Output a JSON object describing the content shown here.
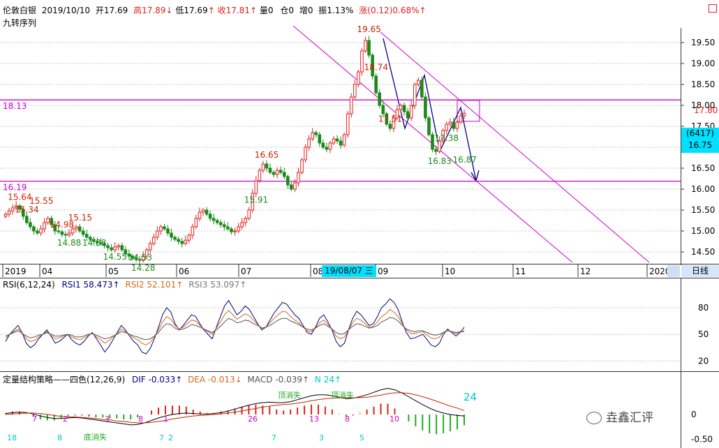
{
  "header": {
    "name": "伦敦白银",
    "date": "2019/10/10",
    "open_label": "开",
    "open": "17.69",
    "high_label": "高",
    "high": "17.89",
    "low_label": "低",
    "low": "17.69",
    "close_label": "收",
    "close": "17.81",
    "vol_label": "量",
    "vol": "0",
    "oi_label": "仓",
    "oi": "0",
    "inc_label": "增",
    "inc": "0",
    "amp_label": "振",
    "amp": "1.13%",
    "chg_label": "涨",
    "chg": "(0.12)",
    "chg_pct": "0.68%",
    "indicator": "九转序列",
    "corner_icon": "square-icon",
    "arrow_up": "↑",
    "arrow_down": "↓"
  },
  "colors": {
    "up": "#e02020",
    "down": "#1a8a1a",
    "magenta": "#cc00cc",
    "rsi1": "#000080",
    "rsi2": "#d2691e",
    "rsi3": "#555555",
    "dif": "#000000",
    "dea": "#cc2200",
    "cyan": "#00c8c8",
    "label_blue": "#1010a0"
  },
  "price_axis": [
    "19.50",
    "19.00",
    "18.50",
    "18.00",
    "17.50",
    "17.00",
    "16.50",
    "16.00",
    "15.50",
    "15.00",
    "14.50"
  ],
  "current_price_tag": "17.80",
  "cursor_tag": {
    "line1": "(6417)",
    "line2": "16.75"
  },
  "support_lines": [
    {
      "label": "18.13",
      "value": 18.13
    },
    {
      "label": "16.19",
      "value": 16.19
    }
  ],
  "price_annotations": [
    {
      "text": "19.65",
      "kind": "high"
    },
    {
      "text": "18.74",
      "kind": "high"
    },
    {
      "text": "17.51",
      "kind": "high"
    },
    {
      "text": "16.65",
      "kind": "high"
    },
    {
      "text": "15.64",
      "kind": "high"
    },
    {
      "text": "15.34",
      "kind": "high"
    },
    {
      "text": "14.98",
      "kind": "high"
    },
    {
      "text": "15.15",
      "kind": "high"
    },
    {
      "text": "15.55",
      "kind": "high"
    },
    {
      "text": "14.88",
      "kind": "low"
    },
    {
      "text": "14.55",
      "kind": "low"
    },
    {
      "text": "14.28",
      "kind": "low"
    },
    {
      "text": "14.53",
      "kind": "low"
    },
    {
      "text": "14.88",
      "kind": "low"
    },
    {
      "text": "15.91",
      "kind": "low"
    },
    {
      "text": "16.83",
      "kind": "low"
    },
    {
      "text": "17.38",
      "kind": "low"
    },
    {
      "text": "16.87",
      "kind": "low"
    }
  ],
  "time_axis": [
    "2019",
    "04",
    "05",
    "06",
    "07",
    "08",
    "09",
    "10",
    "11",
    "12",
    "2020"
  ],
  "time_cursor": "19/08/07 三",
  "period": "日线",
  "rsi": {
    "title": "RSI(6,12,24)",
    "rsi1_label": "RSI1",
    "rsi1": "58.473",
    "rsi2_label": "RSI2",
    "rsi2": "52.101",
    "rsi3_label": "RSI3",
    "rsi3": "53.097",
    "axis": [
      "80",
      "50",
      "20"
    ]
  },
  "macd": {
    "title": "定量结构策略——四色(12,26,9)",
    "dif_label": "DIF",
    "dif": "-0.033",
    "dea_label": "DEA",
    "dea": "-0.013",
    "macd_label": "MACD",
    "macd": "-0.039",
    "n_label": "N",
    "n": "24",
    "axis": [
      "-0.50",
      "0"
    ],
    "big_number": "24",
    "tags": [
      "顶消失",
      "顶消失"
    ],
    "counts_top": [
      "7",
      "2",
      "3",
      "8",
      "1",
      "26",
      "13",
      "8",
      "10"
    ],
    "counts_bottom": [
      "18",
      "8",
      "7",
      "2",
      "7",
      "3",
      "5"
    ],
    "bottom_text": "底消失"
  },
  "watermark": "垚鑫汇评",
  "chart_data": [
    {
      "type": "candlestick",
      "title": "伦敦白银",
      "xlabel": "",
      "ylabel": "",
      "x_ticks": [
        "2019",
        "04",
        "05",
        "06",
        "07",
        "08",
        "09",
        "10",
        "11",
        "12",
        "2020"
      ],
      "ylim": [
        14.25,
        19.85
      ],
      "annotated_highs": [
        19.65,
        18.74,
        17.51,
        16.65,
        15.64,
        15.34,
        14.98,
        15.15,
        15.55
      ],
      "annotated_lows": [
        14.88,
        14.55,
        14.28,
        14.53,
        14.88,
        15.91,
        16.83,
        17.38,
        16.87
      ],
      "horizontal_lines": [
        18.13,
        16.19
      ],
      "close_series": [
        15.4,
        15.48,
        15.55,
        15.6,
        15.52,
        15.35,
        15.2,
        15.1,
        15.0,
        14.95,
        15.05,
        15.2,
        15.3,
        15.15,
        15.0,
        14.98,
        14.92,
        14.9,
        14.95,
        15.05,
        15.1,
        15.0,
        14.92,
        14.85,
        14.8,
        14.75,
        14.72,
        14.7,
        14.65,
        14.6,
        14.55,
        14.62,
        14.65,
        14.55,
        14.45,
        14.4,
        14.35,
        14.32,
        14.3,
        14.4,
        14.55,
        14.7,
        14.85,
        15.0,
        15.1,
        15.05,
        14.95,
        14.85,
        14.8,
        14.75,
        14.7,
        14.78,
        14.9,
        15.1,
        15.3,
        15.45,
        15.5,
        15.4,
        15.3,
        15.25,
        15.2,
        15.15,
        15.1,
        15.05,
        14.98,
        15.0,
        15.1,
        15.2,
        15.3,
        15.5,
        15.9,
        16.2,
        16.45,
        16.6,
        16.5,
        16.4,
        16.35,
        16.45,
        16.4,
        16.3,
        16.1,
        16.0,
        16.15,
        16.4,
        16.7,
        17.0,
        17.2,
        17.35,
        17.3,
        17.1,
        17.0,
        16.95,
        17.1,
        17.2,
        17.15,
        17.05,
        17.3,
        17.8,
        18.2,
        18.5,
        18.8,
        19.3,
        19.55,
        19.2,
        18.7,
        18.3,
        18.0,
        17.8,
        17.55,
        17.45,
        17.7,
        17.9,
        18.0,
        17.85,
        17.7,
        18.0,
        18.5,
        18.6,
        18.2,
        17.7,
        17.3,
        16.95,
        16.9,
        17.15,
        17.4,
        17.55,
        17.6,
        17.45,
        17.6,
        17.75,
        17.81
      ],
      "rsi_series": [
        {
          "name": "RSI1",
          "values": [
            42,
            50,
            55,
            60,
            52,
            40,
            35,
            38,
            45,
            50,
            55,
            48,
            40,
            42,
            46,
            50,
            44,
            40,
            38,
            42,
            48,
            52,
            45,
            38,
            30,
            36,
            44,
            52,
            60,
            55,
            48,
            42,
            38,
            30,
            28,
            34,
            45,
            58,
            72,
            80,
            75,
            62,
            55,
            60,
            66,
            72,
            70,
            62,
            55,
            50,
            45,
            58,
            70,
            82,
            88,
            80,
            72,
            76,
            82,
            78,
            70,
            62,
            55,
            58,
            66,
            74,
            80,
            86,
            84,
            78,
            72,
            68,
            60,
            52,
            50,
            58,
            68,
            72,
            64,
            55,
            42,
            36,
            40,
            55,
            68,
            76,
            72,
            66,
            60,
            62,
            70,
            80,
            84,
            90,
            86,
            78,
            64,
            52,
            45,
            46,
            48,
            50,
            44,
            38,
            36,
            40,
            50,
            56,
            52,
            48,
            52,
            58
          ]
        },
        {
          "name": "RSI2",
          "values": [
            46,
            50,
            53,
            56,
            52,
            45,
            42,
            43,
            47,
            50,
            53,
            49,
            45,
            46,
            48,
            50,
            47,
            45,
            44,
            46,
            49,
            51,
            47,
            44,
            40,
            43,
            47,
            51,
            56,
            53,
            50,
            46,
            44,
            40,
            38,
            41,
            47,
            55,
            64,
            70,
            67,
            60,
            56,
            58,
            62,
            66,
            65,
            60,
            56,
            53,
            50,
            57,
            64,
            72,
            77,
            72,
            67,
            70,
            73,
            71,
            66,
            61,
            57,
            58,
            63,
            68,
            72,
            76,
            75,
            70,
            66,
            63,
            58,
            54,
            53,
            57,
            63,
            66,
            61,
            56,
            48,
            45,
            47,
            55,
            63,
            68,
            66,
            62,
            58,
            59,
            64,
            70,
            73,
            78,
            75,
            70,
            62,
            55,
            51,
            51,
            52,
            53,
            49,
            46,
            45,
            47,
            52,
            55,
            53,
            51,
            52,
            54
          ]
        },
        {
          "name": "RSI3",
          "values": [
            48,
            50,
            52,
            54,
            51,
            48,
            46,
            47,
            49,
            50,
            52,
            50,
            48,
            48,
            49,
            50,
            49,
            47,
            47,
            48,
            50,
            51,
            49,
            47,
            45,
            46,
            48,
            50,
            53,
            52,
            50,
            48,
            47,
            45,
            44,
            45,
            48,
            52,
            58,
            62,
            61,
            57,
            55,
            56,
            58,
            61,
            60,
            58,
            56,
            54,
            52,
            55,
            59,
            64,
            68,
            66,
            63,
            64,
            66,
            65,
            62,
            60,
            57,
            58,
            60,
            63,
            66,
            68,
            68,
            65,
            63,
            61,
            58,
            56,
            55,
            57,
            60,
            62,
            59,
            56,
            52,
            50,
            51,
            55,
            59,
            62,
            61,
            59,
            57,
            58,
            60,
            64,
            66,
            69,
            68,
            65,
            60,
            56,
            54,
            53,
            54,
            54,
            52,
            50,
            49,
            50,
            52,
            54,
            53,
            52,
            53,
            53
          ]
        }
      ],
      "rsi_ylim": [
        10,
        98
      ],
      "macd_series": [
        {
          "name": "DIF",
          "values": [
            0.02,
            0.04,
            0.05,
            0.04,
            0.01,
            -0.03,
            -0.06,
            -0.08,
            -0.08,
            -0.07,
            -0.06,
            -0.07,
            -0.09,
            -0.11,
            -0.13,
            -0.15,
            -0.17,
            -0.19,
            -0.21,
            -0.2,
            -0.17,
            -0.12,
            -0.07,
            -0.03,
            0.0,
            0.02,
            0.03,
            0.02,
            0.01,
            0.01,
            0.02,
            0.04,
            0.07,
            0.11,
            0.15,
            0.19,
            0.22,
            0.24,
            0.25,
            0.24,
            0.24,
            0.26,
            0.3,
            0.34,
            0.38,
            0.4,
            0.4,
            0.38,
            0.35,
            0.32,
            0.33,
            0.36,
            0.4,
            0.45,
            0.5,
            0.53,
            0.5,
            0.44,
            0.36,
            0.28,
            0.2,
            0.13,
            0.07,
            0.03,
            0.0,
            -0.02,
            -0.03
          ]
        },
        {
          "name": "DEA",
          "values": [
            0.0,
            0.01,
            0.02,
            0.03,
            0.03,
            0.02,
            0.0,
            -0.02,
            -0.04,
            -0.05,
            -0.05,
            -0.06,
            -0.07,
            -0.08,
            -0.1,
            -0.11,
            -0.13,
            -0.14,
            -0.16,
            -0.17,
            -0.17,
            -0.16,
            -0.14,
            -0.12,
            -0.09,
            -0.07,
            -0.05,
            -0.03,
            -0.02,
            -0.01,
            0.0,
            0.01,
            0.03,
            0.05,
            0.07,
            0.1,
            0.12,
            0.15,
            0.17,
            0.19,
            0.2,
            0.21,
            0.23,
            0.25,
            0.28,
            0.3,
            0.32,
            0.33,
            0.34,
            0.34,
            0.34,
            0.34,
            0.35,
            0.37,
            0.39,
            0.42,
            0.44,
            0.44,
            0.43,
            0.4,
            0.36,
            0.32,
            0.27,
            0.22,
            0.17,
            0.13,
            0.08
          ]
        }
      ],
      "macd_ylim": [
        -0.65,
        0.65
      ]
    }
  ]
}
